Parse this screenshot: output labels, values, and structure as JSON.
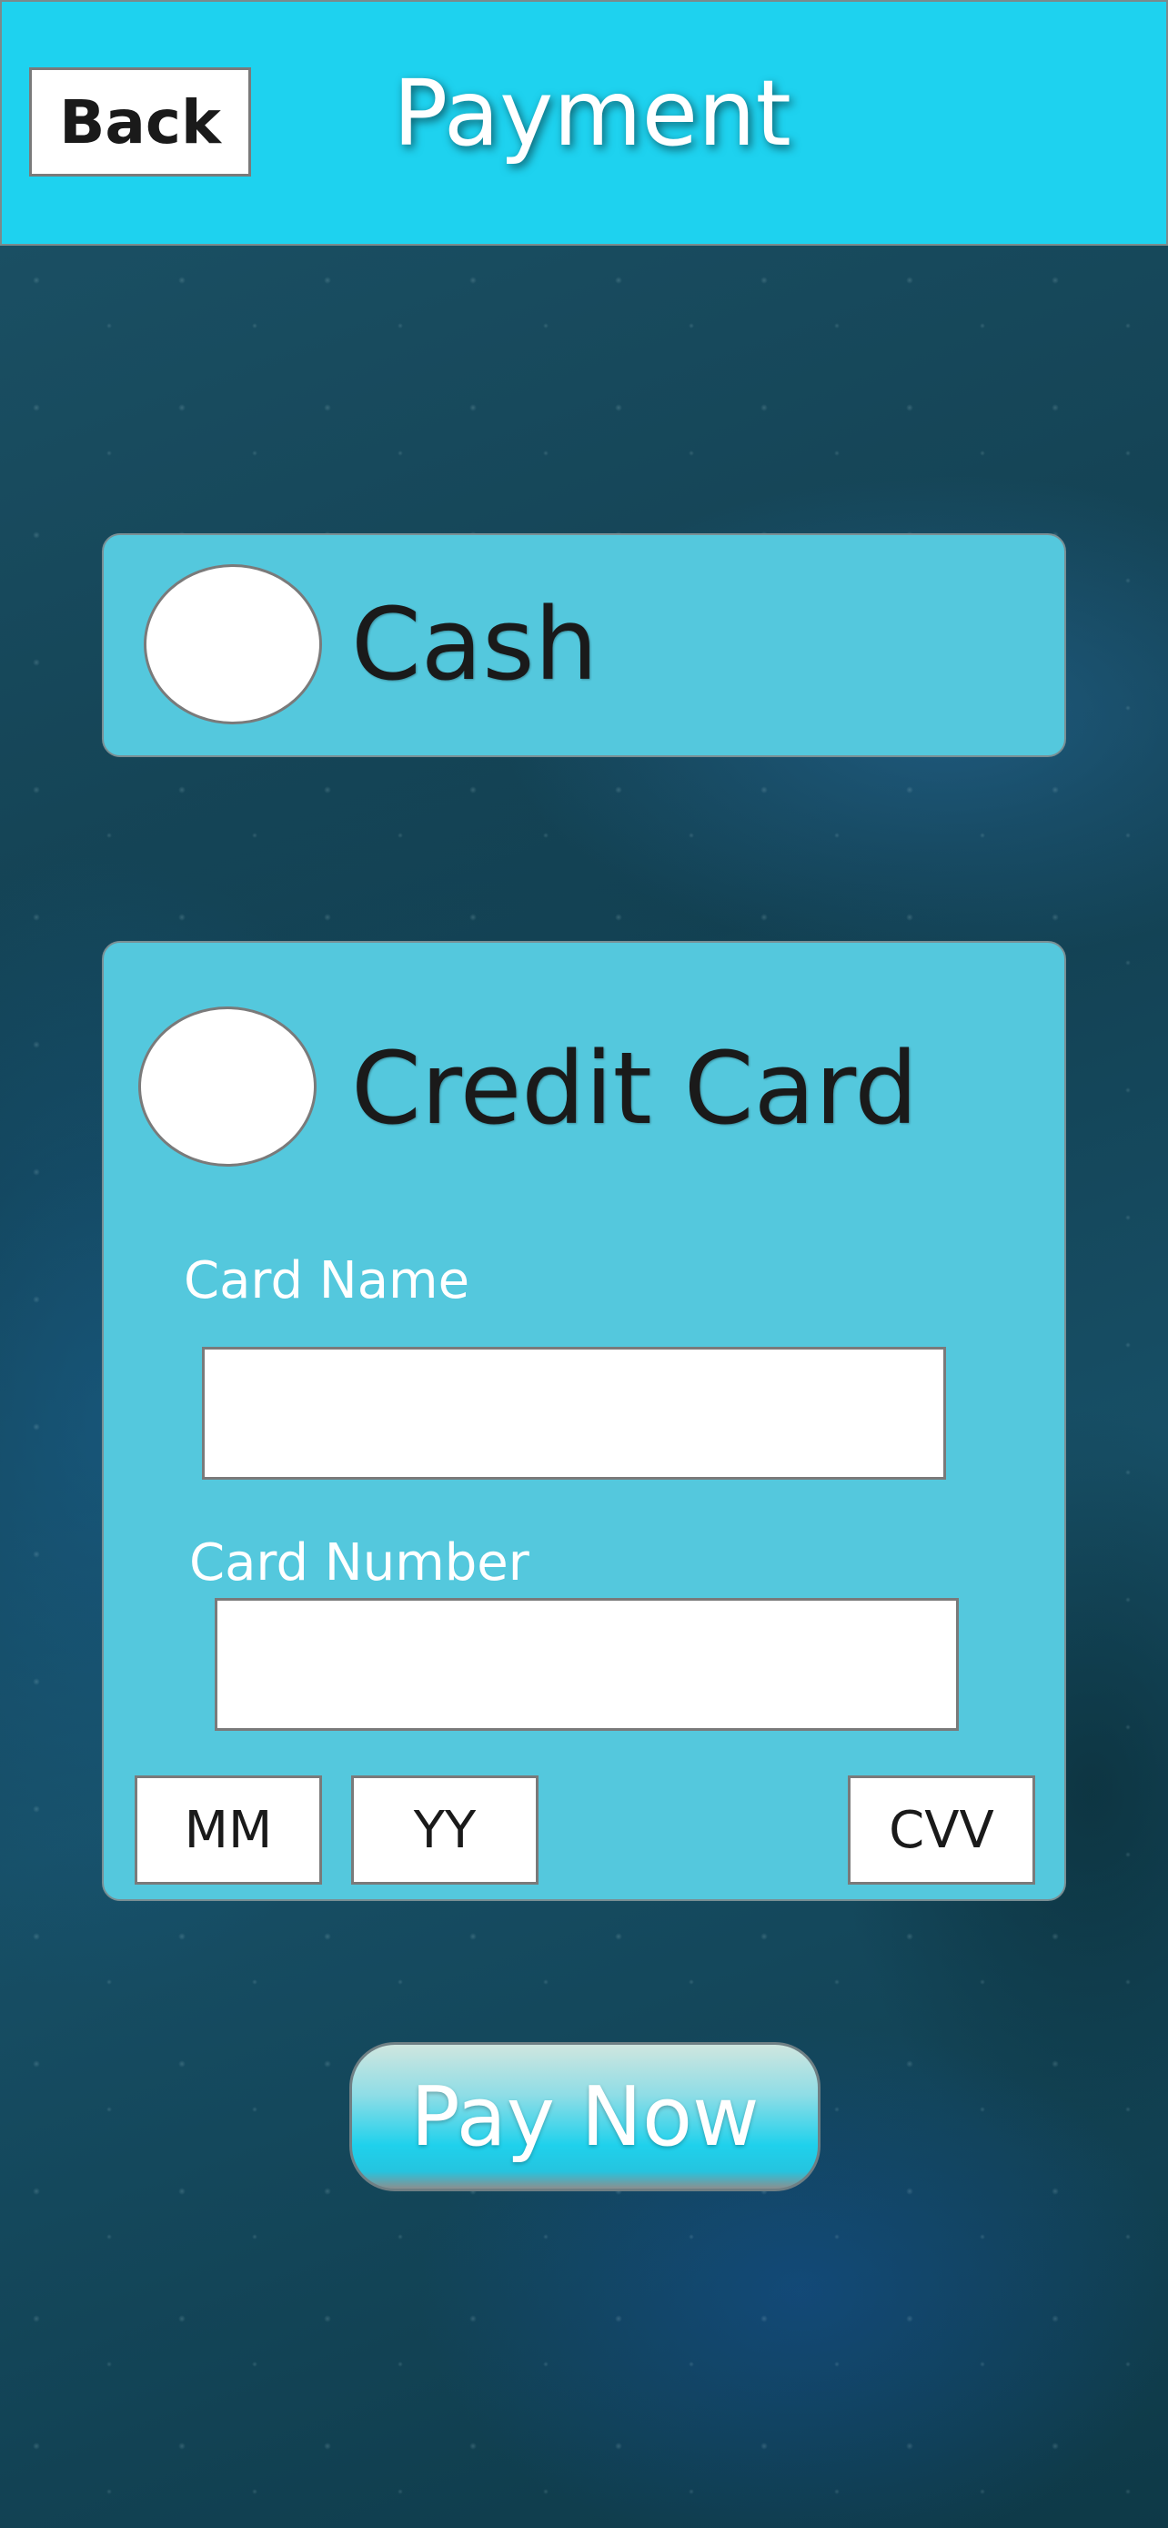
{
  "header": {
    "back_label": "Back",
    "title": "Payment"
  },
  "options": {
    "cash_label": "Cash",
    "credit_label": "Credit Card"
  },
  "card_form": {
    "name_label": "Card Name",
    "name_value": "",
    "number_label": "Card Number",
    "number_value": "",
    "month_placeholder": "MM",
    "year_placeholder": "YY",
    "cvv_placeholder": "CVV"
  },
  "actions": {
    "pay_label": "Pay Now"
  },
  "colors": {
    "header_bg": "#1ed2ef",
    "panel_bg": "#54c8dd",
    "accent": "#1fd1ec"
  }
}
